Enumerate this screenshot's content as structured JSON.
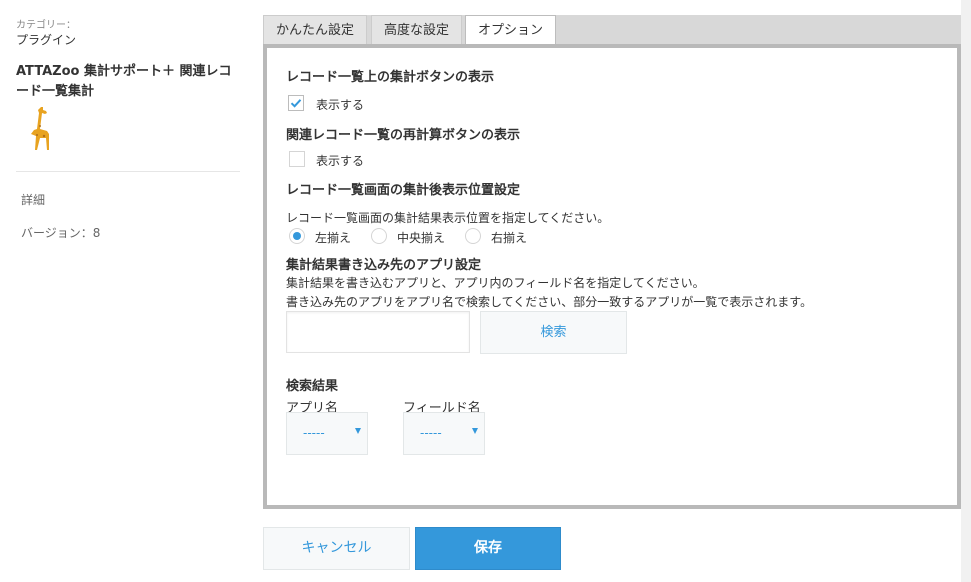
{
  "sidebar": {
    "category_label": "カテゴリー：",
    "category_value": "プラグイン",
    "plugin_name": "ATTAZoo 集計サポート＋ 関連レコード一覧集計",
    "logo_icon": "giraffe-icon",
    "detail_label": "詳細",
    "version_label": "バージョン：8"
  },
  "tabs": [
    {
      "label": "かんたん設定",
      "active": false
    },
    {
      "label": "高度な設定",
      "active": false
    },
    {
      "label": "オプション",
      "active": true
    }
  ],
  "options": {
    "section1": {
      "title": "レコード一覧上の集計ボタンの表示",
      "checkbox_label": "表示する",
      "checked": true
    },
    "section2": {
      "title": "関連レコード一覧の再計算ボタンの表示",
      "checkbox_label": "表示する",
      "checked": false
    },
    "section3": {
      "title": "レコード一覧画面の集計後表示位置設定",
      "description": "レコード一覧画面の集計結果表示位置を指定してください。",
      "radios": [
        {
          "label": "左揃え",
          "selected": true
        },
        {
          "label": "中央揃え",
          "selected": false
        },
        {
          "label": "右揃え",
          "selected": false
        }
      ]
    },
    "section4": {
      "title": "集計結果書き込み先のアプリ設定",
      "description1": "集計結果を書き込むアプリと、アプリ内のフィールド名を指定してください。",
      "description2": "書き込み先のアプリをアプリ名で検索してください、部分一致するアプリが一覧で表示されます。",
      "search_value": "",
      "search_button": "検索"
    },
    "results": {
      "title": "検索結果",
      "app_label": "アプリ名",
      "app_value": "-----",
      "field_label": "フィールド名",
      "field_value": "-----"
    }
  },
  "footer": {
    "cancel_label": "キャンセル",
    "save_label": "保存"
  },
  "colors": {
    "accent": "#3498db",
    "panel_border": "#b9b9b9",
    "tab_bar": "#d8d8d8"
  }
}
